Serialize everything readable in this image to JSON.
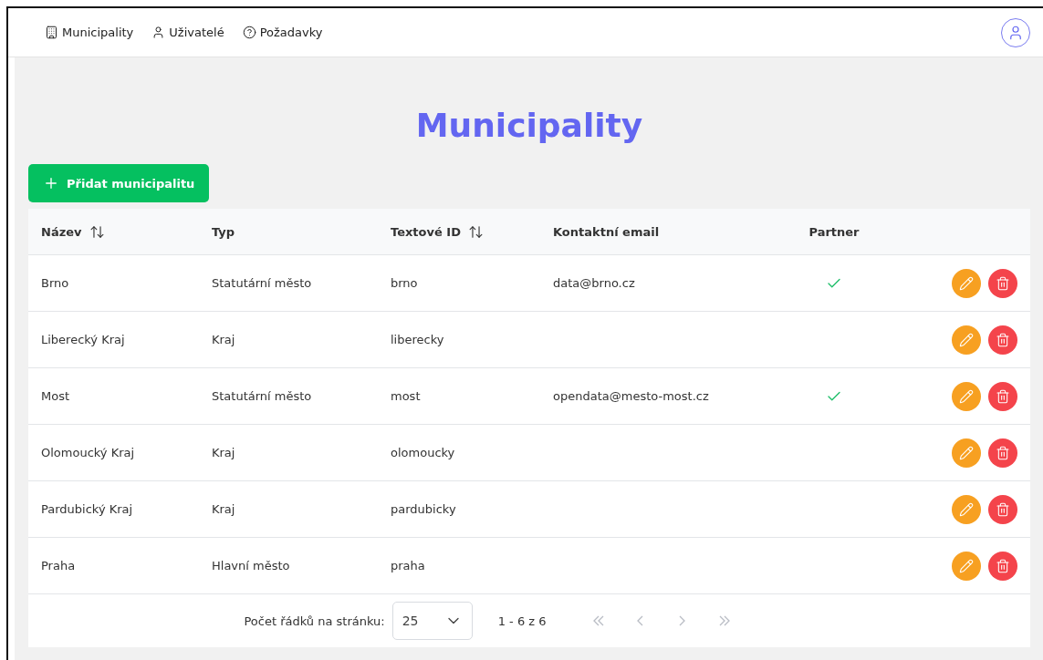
{
  "nav": {
    "items": [
      {
        "label": "Municipality",
        "kind": "building"
      },
      {
        "label": "Uživatelé",
        "kind": "user"
      },
      {
        "label": "Požadavky",
        "kind": "help"
      }
    ]
  },
  "page_title": "Municipality",
  "add_button": "Přidat municipalitu",
  "table": {
    "columns": [
      {
        "label": "Název",
        "sortable": true
      },
      {
        "label": "Typ",
        "sortable": false
      },
      {
        "label": "Textové ID",
        "sortable": true
      },
      {
        "label": "Kontaktní email",
        "sortable": false
      },
      {
        "label": "Partner",
        "sortable": false
      }
    ],
    "rows": [
      {
        "name": "Brno",
        "type": "Statutární město",
        "text_id": "brno",
        "email": "data@brno.cz",
        "partner": true
      },
      {
        "name": "Liberecký Kraj",
        "type": "Kraj",
        "text_id": "liberecky",
        "email": null,
        "partner": false
      },
      {
        "name": "Most",
        "type": "Statutární město",
        "text_id": "most",
        "email": "opendata@mesto-most.cz",
        "partner": true
      },
      {
        "name": "Olomoucký Kraj",
        "type": "Kraj",
        "text_id": "olomoucky",
        "email": null,
        "partner": false
      },
      {
        "name": "Pardubický Kraj",
        "type": "Kraj",
        "text_id": "pardubicky",
        "email": null,
        "partner": false
      },
      {
        "name": "Praha",
        "type": "Hlavní město",
        "text_id": "praha",
        "email": null,
        "partner": false
      }
    ]
  },
  "pagination": {
    "rows_label": "Počet řádků na stránku:",
    "page_size": "25",
    "range": "1 - 6 z 6",
    "buttons": [
      {
        "kind": "first",
        "disabled": true
      },
      {
        "kind": "prev",
        "disabled": true
      },
      {
        "kind": "next",
        "disabled": true
      },
      {
        "kind": "last",
        "disabled": true
      }
    ]
  }
}
